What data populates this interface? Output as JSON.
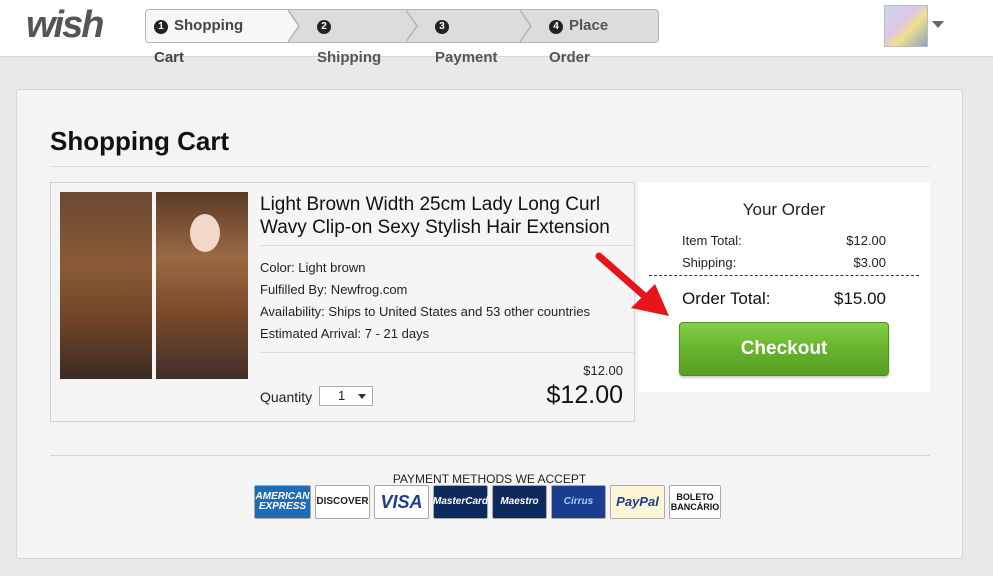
{
  "header": {
    "logo": "wish",
    "steps": [
      {
        "num": "1",
        "label": "Shopping Cart"
      },
      {
        "num": "2",
        "label": "Shipping"
      },
      {
        "num": "3",
        "label": "Payment"
      },
      {
        "num": "4",
        "label": "Place Order"
      }
    ]
  },
  "cart": {
    "title": "Shopping Cart",
    "item": {
      "title": "Light Brown Width 25cm Lady Long Curl Wavy Clip-on Sexy Stylish Hair Extension",
      "color": "Color: Light brown",
      "fulfilled": "Fulfilled By: Newfrog.com",
      "availability": "Availability: Ships to United States and 53 other countries",
      "arrival": "Estimated Arrival: 7 - 21 days",
      "unit_price": "$12.00",
      "price": "$12.00",
      "quantity_label": "Quantity",
      "quantity": "1"
    }
  },
  "order": {
    "title": "Your Order",
    "item_total_label": "Item Total:",
    "item_total": "$12.00",
    "shipping_label": "Shipping:",
    "shipping": "$3.00",
    "total_label": "Order Total:",
    "total": "$15.00",
    "checkout_label": "Checkout"
  },
  "payment": {
    "label": "PAYMENT METHODS WE ACCEPT",
    "methods": [
      "AMERICAN EXPRESS",
      "DISCOVER",
      "VISA",
      "MasterCard",
      "Maestro",
      "Cirrus",
      "PayPal",
      "BOLETO BANCÁRIO"
    ]
  },
  "colors": {
    "checkout_green": "#64b12b",
    "arrow_red": "#e8141b"
  }
}
